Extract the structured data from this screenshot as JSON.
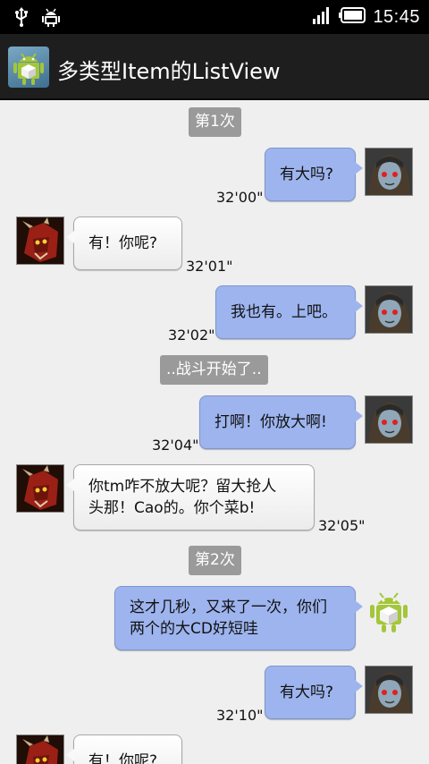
{
  "status_bar": {
    "time": "15:45",
    "icons": [
      "usb-icon",
      "android-debug-icon",
      "signal-icon",
      "battery-icon"
    ]
  },
  "action_bar": {
    "title": "多类型Item的ListView",
    "icon": "android-box-icon"
  },
  "colors": {
    "right_bubble": "#9db4ee",
    "left_bubble": "#ffffff",
    "divider": "#9a9a9a",
    "background": "#efefef"
  },
  "messages": [
    {
      "type": "divider",
      "text": "第1次"
    },
    {
      "type": "right",
      "text": "有大吗?",
      "time": "32'00\"",
      "avatar": "girl-avatar"
    },
    {
      "type": "left",
      "text": "有！你呢?",
      "time": "32'01\"",
      "avatar": "orc-avatar"
    },
    {
      "type": "right",
      "text": "我也有。上吧。",
      "time": "32'02\"",
      "avatar": "girl-avatar"
    },
    {
      "type": "divider",
      "text": "..战斗开始了.."
    },
    {
      "type": "right",
      "text": "打啊！你放大啊!",
      "time": "32'04\"",
      "avatar": "girl-avatar"
    },
    {
      "type": "left",
      "text_lines": [
        "你tm咋不放大呢？留大抢人",
        "头那！Cao的。你个菜b!"
      ],
      "time": "32'05\"",
      "avatar": "orc-avatar"
    },
    {
      "type": "divider",
      "text": "第2次"
    },
    {
      "type": "right",
      "text_lines": [
        "这才几秒，又来了一次，你们",
        "两个的大CD好短哇"
      ],
      "time": "",
      "avatar": "android-avatar"
    },
    {
      "type": "right",
      "text": "有大吗?",
      "time": "32'10\"",
      "avatar": "girl-avatar"
    },
    {
      "type": "left",
      "text": "有！你呢?",
      "time": "",
      "avatar": "orc-avatar"
    }
  ]
}
